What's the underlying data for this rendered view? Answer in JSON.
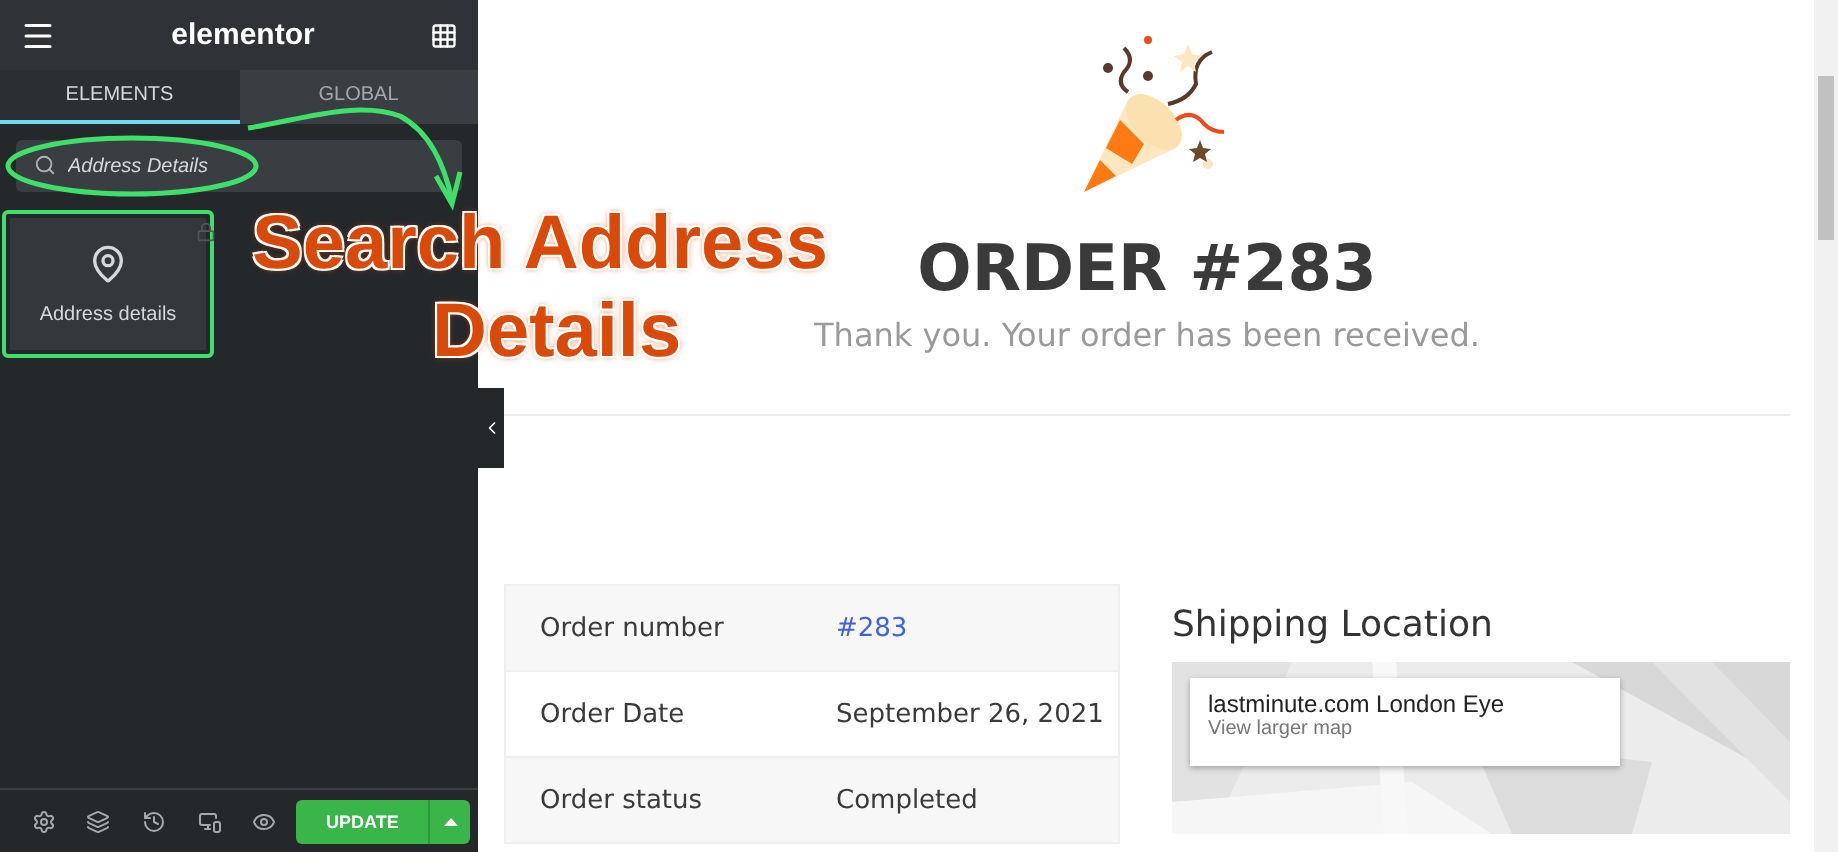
{
  "sidebar": {
    "logo": "elementor",
    "tabs": [
      {
        "label": "ELEMENTS",
        "selected": true
      },
      {
        "label": "GLOBAL",
        "selected": false
      }
    ],
    "search": {
      "value": "Address Details"
    },
    "widgets": [
      {
        "label": "Address details",
        "highlighted": true
      }
    ],
    "footer": {
      "update_button": "UPDATE"
    }
  },
  "annotation": {
    "text_lines": [
      "Search Address",
      "Details"
    ]
  },
  "order": {
    "title": "ORDER #283",
    "subtitle": "Thank you. Your order has been received.",
    "rows": [
      {
        "label": "Order number",
        "value": "#283",
        "kind": "link"
      },
      {
        "label": "Order Date",
        "value": "September 26, 2021",
        "kind": "text"
      },
      {
        "label": "Order status",
        "value": "Completed",
        "kind": "text"
      }
    ]
  },
  "shipping": {
    "title": "Shipping Location",
    "place": "lastminute.com London Eye",
    "map_link": "View larger map"
  }
}
